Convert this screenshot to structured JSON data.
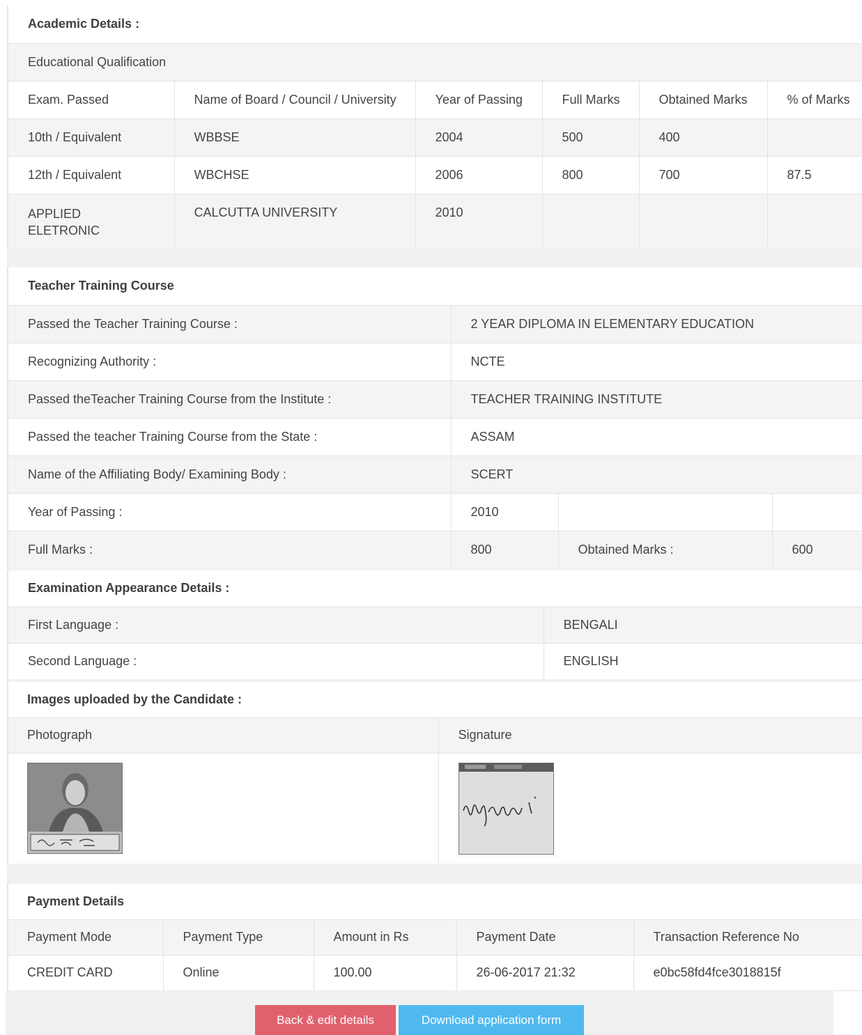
{
  "academic": {
    "title": "Academic Details :",
    "subtitle": "Educational Qualification",
    "headers": [
      "Exam. Passed",
      "Name of Board / Council / University",
      "Year of Passing",
      "Full Marks",
      "Obtained Marks",
      "% of Marks"
    ],
    "rows": [
      [
        "10th / Equivalent",
        "WBBSE",
        "2004",
        "500",
        "400",
        ""
      ],
      [
        "12th / Equivalent",
        "WBCHSE",
        "2006",
        "800",
        "700",
        "87.5"
      ],
      [
        "APPLIED ELETRONIC",
        "CALCUTTA UNIVERSITY",
        "2010",
        "",
        "",
        ""
      ]
    ]
  },
  "training": {
    "title": "Teacher Training Course",
    "rows": [
      {
        "label": "Passed the Teacher Training Course :",
        "value": "2 YEAR DIPLOMA IN ELEMENTARY EDUCATION"
      },
      {
        "label": "Recognizing Authority :",
        "value": "NCTE"
      },
      {
        "label": "Passed theTeacher Training Course from the Institute :",
        "value": "TEACHER TRAINING INSTITUTE"
      },
      {
        "label": "Passed the teacher Training Course from the State :",
        "value": "ASSAM"
      },
      {
        "label": "Name of the Affiliating Body/ Examining Body :",
        "value": "SCERT"
      }
    ],
    "year_label": "Year of Passing :",
    "year_value": "2010",
    "full_marks_label": "Full Marks :",
    "full_marks_value": "800",
    "obtained_label": "Obtained Marks :",
    "obtained_value": "600"
  },
  "exam": {
    "title": "Examination Appearance Details :",
    "first_label": "First Language :",
    "first_value": "BENGALI",
    "second_label": "Second Language :",
    "second_value": "ENGLISH"
  },
  "images": {
    "title": "Images uploaded by the Candidate :",
    "photo_label": "Photograph",
    "signature_label": "Signature"
  },
  "payment": {
    "title": "Payment Details",
    "headers": [
      "Payment Mode",
      "Payment Type",
      "Amount in Rs",
      "Payment Date",
      "Transaction Reference No"
    ],
    "row": [
      "CREDIT CARD",
      "Online",
      "100.00",
      "26-06-2017 21:32",
      "e0bc58fd4fce3018815f"
    ]
  },
  "buttons": {
    "back_label": "Back & edit details",
    "download_label": "Download application form",
    "back_color": "#e0616d",
    "download_color": "#4fb9ef"
  }
}
